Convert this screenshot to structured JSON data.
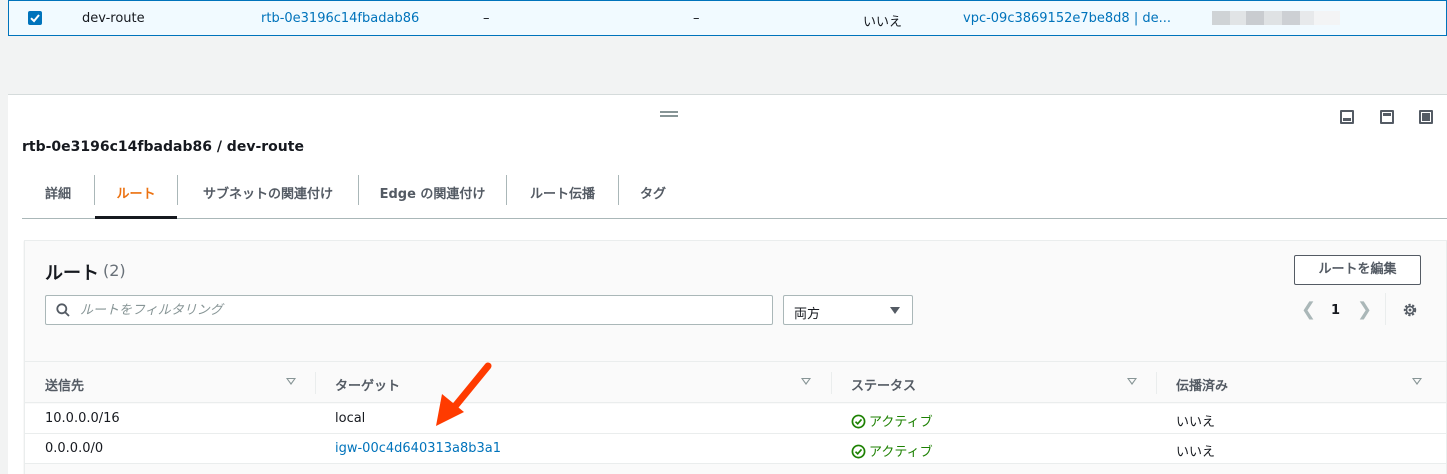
{
  "top_row": {
    "name": "dev-route",
    "route_table_id": "rtb-0e3196c14fbadab86",
    "col3": "–",
    "col4": "–",
    "main": "いいえ",
    "vpc": "vpc-09c3869152e7be8d8 | de..."
  },
  "split_panel": {
    "title": "rtb-0e3196c14fbadab86 / dev-route",
    "tabs": [
      {
        "label": "詳細"
      },
      {
        "label": "ルート"
      },
      {
        "label": "サブネットの関連付け"
      },
      {
        "label": "Edge の関連付け"
      },
      {
        "label": "ルート伝播"
      },
      {
        "label": "タグ"
      }
    ],
    "active_tab": "ルート"
  },
  "routes": {
    "title": "ルート",
    "count": "(2)",
    "edit_button": "ルートを編集",
    "search_placeholder": "ルートをフィルタリング",
    "direction_select": "両方",
    "page": "1",
    "columns": [
      "送信先",
      "ターゲット",
      "ステータス",
      "伝播済み"
    ],
    "rows": [
      {
        "destination": "10.0.0.0/16",
        "target": "local",
        "status": "アクティブ",
        "propagated": "いいえ"
      },
      {
        "destination": "0.0.0.0/0",
        "target": "igw-00c4d640313a8b3a1",
        "status": "アクティブ",
        "propagated": "いいえ"
      }
    ]
  },
  "colors": {
    "link": "#0073bb",
    "active_tab": "#ec7211",
    "status_active": "#1d8102",
    "annotation_arrow": "#ff3b00"
  },
  "icons": [
    "checkbox-checked-icon",
    "drag-handle-icon",
    "panel-bottom-icon",
    "panel-side-icon",
    "panel-full-icon",
    "search-icon",
    "chevron-left-icon",
    "chevron-right-icon",
    "gear-icon",
    "status-success-icon",
    "sort-caret-icon",
    "annotation-arrow-icon"
  ]
}
